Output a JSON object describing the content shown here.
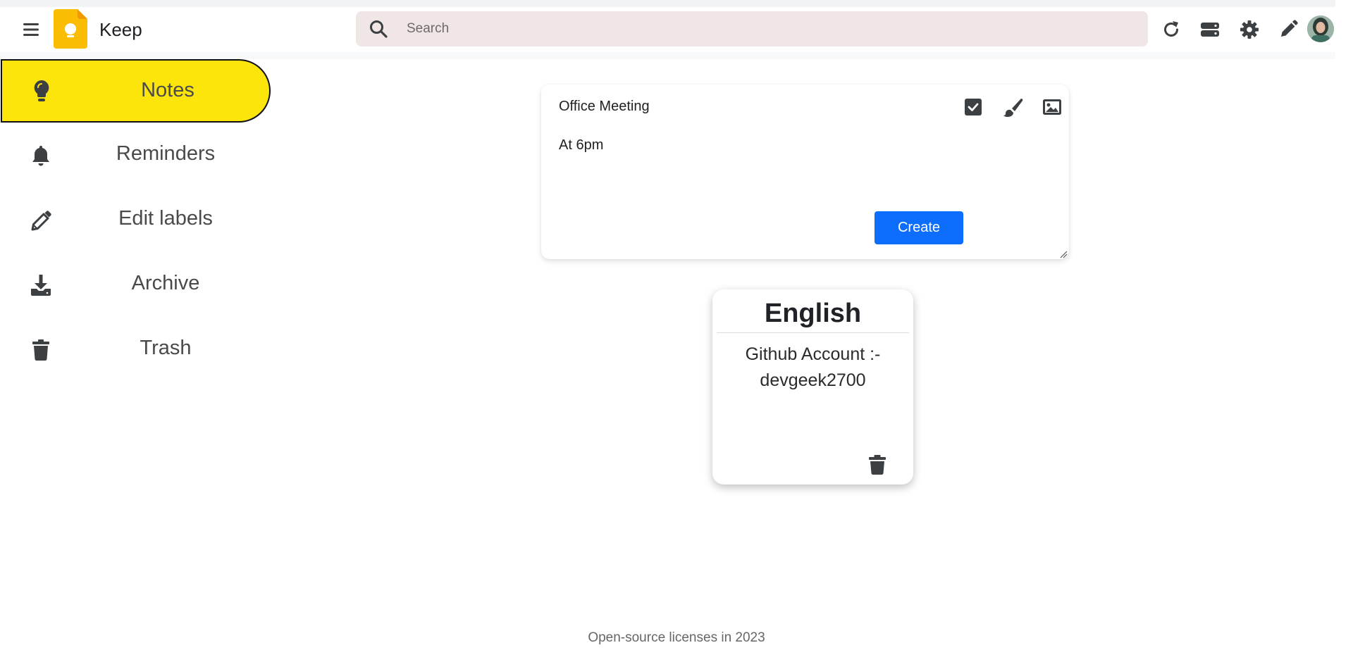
{
  "header": {
    "app_title": "Keep",
    "search_placeholder": "Search",
    "search_value": "",
    "icons": [
      "menu-icon",
      "keep-logo",
      "search-icon",
      "refresh-icon",
      "list-view-icon",
      "settings-icon",
      "pencil-icon",
      "avatar"
    ]
  },
  "sidebar": {
    "items": [
      {
        "label": "Notes",
        "icon": "bulb-icon",
        "active": true
      },
      {
        "label": "Reminders",
        "icon": "bell-icon",
        "active": false
      },
      {
        "label": "Edit labels",
        "icon": "pencil-icon",
        "active": false
      },
      {
        "label": "Archive",
        "icon": "archive-download-icon",
        "active": false
      },
      {
        "label": "Trash",
        "icon": "trash-icon",
        "active": false
      }
    ],
    "active_color": "#fbe50b"
  },
  "composer": {
    "title_value": "Office Meeting",
    "body_value": "At 6pm",
    "create_label": "Create",
    "icons": [
      "checkbox-icon",
      "brush-icon",
      "image-icon"
    ],
    "button_color": "#0d6efd"
  },
  "notes": [
    {
      "title": "English",
      "content": "Github Account :- devgeek2700"
    }
  ],
  "footer": {
    "text": "Open-source licenses in 2023"
  }
}
